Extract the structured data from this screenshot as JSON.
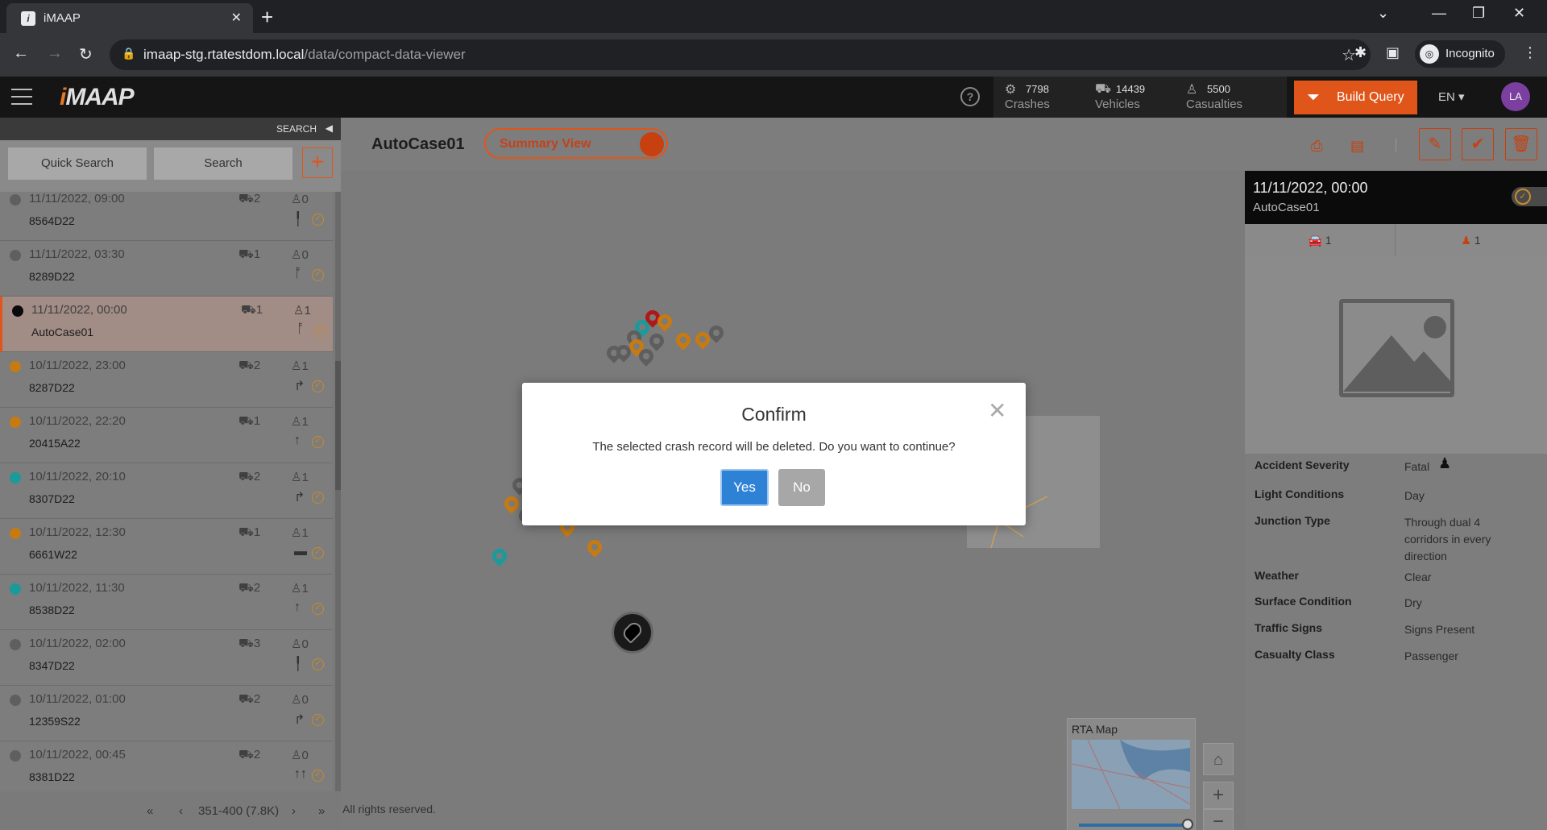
{
  "browser": {
    "tab_title": "iMAAP",
    "tab_favicon": "i",
    "url_host": "imaap-stg.rtatestdom.local",
    "url_path": "/data/compact-data-viewer",
    "profile_label": "Incognito"
  },
  "app": {
    "logo": "iMAAP",
    "stats": [
      {
        "value": "7798",
        "label": "Crashes",
        "icon": "crash-icon"
      },
      {
        "value": "14439",
        "label": "Vehicles",
        "icon": "vehicle-icon"
      },
      {
        "value": "5500",
        "label": "Casualties",
        "icon": "person-icon"
      }
    ],
    "build_query_label": "Build Query",
    "language": "EN",
    "avatar_initials": "LA",
    "colors": {
      "accent": "#e0561a",
      "header_bg": "#151515"
    }
  },
  "search": {
    "strip_label": "SEARCH",
    "quick_search_label": "Quick Search",
    "search_label": "Search",
    "add_label": "+"
  },
  "records": [
    {
      "date": "11/11/2022, 09:00",
      "code": "8564D22",
      "vehicles": "2",
      "casualties": "0",
      "dot": "#5f5f5f",
      "mark": "╿"
    },
    {
      "date": "11/11/2022, 03:30",
      "code": "8289D22",
      "vehicles": "1",
      "casualties": "0",
      "dot": "#5f5f5f",
      "mark": "ᚩ"
    },
    {
      "date": "11/11/2022, 00:00",
      "code": "AutoCase01",
      "vehicles": "1",
      "casualties": "1",
      "dot": "#0a0a0a",
      "mark": "ᚩ",
      "selected": true
    },
    {
      "date": "10/11/2022, 23:00",
      "code": "8287D22",
      "vehicles": "2",
      "casualties": "1",
      "dot": "#c67a12",
      "mark": "↱"
    },
    {
      "date": "10/11/2022, 22:20",
      "code": "20415A22",
      "vehicles": "1",
      "casualties": "1",
      "dot": "#c67a12",
      "mark": "↑"
    },
    {
      "date": "10/11/2022, 20:10",
      "code": "8307D22",
      "vehicles": "2",
      "casualties": "1",
      "dot": "#1a9a9a",
      "mark": "↱"
    },
    {
      "date": "10/11/2022, 12:30",
      "code": "6661W22",
      "vehicles": "1",
      "casualties": "1",
      "dot": "#c67a12",
      "mark": "▬"
    },
    {
      "date": "10/11/2022, 11:30",
      "code": "8538D22",
      "vehicles": "2",
      "casualties": "1",
      "dot": "#1a9a9a",
      "mark": "↑"
    },
    {
      "date": "10/11/2022, 02:00",
      "code": "8347D22",
      "vehicles": "3",
      "casualties": "0",
      "dot": "#5f5f5f",
      "mark": "╿"
    },
    {
      "date": "10/11/2022, 01:00",
      "code": "12359S22",
      "vehicles": "2",
      "casualties": "0",
      "dot": "#5f5f5f",
      "mark": "↱"
    },
    {
      "date": "10/11/2022, 00:45",
      "code": "8381D22",
      "vehicles": "2",
      "casualties": "0",
      "dot": "#5f5f5f",
      "mark": "↑↑"
    }
  ],
  "pager": {
    "first": "«",
    "prev": "‹",
    "range": "351-400 (7.8K)",
    "next": "›",
    "last": "»"
  },
  "main": {
    "case_title": "AutoCase01",
    "summary_view_label": "Summary View",
    "copyright": "All rights reserved.",
    "rta_map_label": "RTA Map"
  },
  "detail": {
    "datetime": "11/11/2022, 00:00",
    "code": "AutoCase01",
    "vehicle_count": "1",
    "casualty_count": "1",
    "fields": [
      {
        "key": "Accident Severity",
        "value": "Fatal"
      },
      {
        "key": "Light Conditions",
        "value": "Day"
      },
      {
        "key": "Junction Type",
        "value": "Through dual 4 corridors in every direction"
      },
      {
        "key": "Weather",
        "value": "Clear"
      },
      {
        "key": "Surface Condition",
        "value": "Dry"
      },
      {
        "key": "Traffic Signs",
        "value": "Signs Present"
      },
      {
        "key": "Casualty Class",
        "value": "Passenger"
      }
    ]
  },
  "modal": {
    "title": "Confirm",
    "message": "The selected crash record will be deleted. Do you want to continue?",
    "yes_label": "Yes",
    "no_label": "No"
  },
  "map_pins": [
    {
      "color": "#b01818"
    },
    {
      "color": "#1a9a9a"
    },
    {
      "color": "#c67a12"
    },
    {
      "color": "#5e5e5e"
    }
  ]
}
